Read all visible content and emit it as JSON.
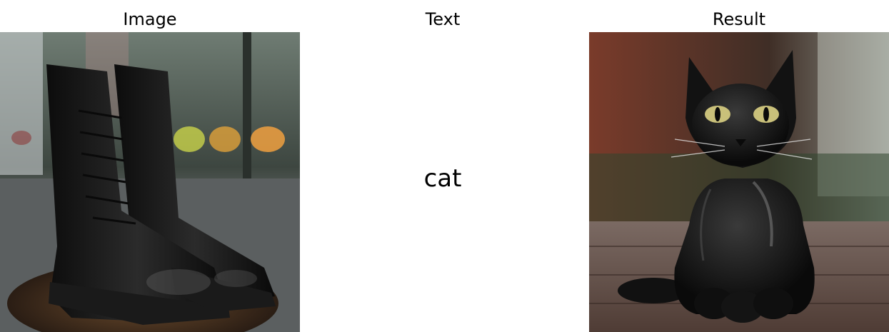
{
  "columns": {
    "image": "Image",
    "text": "Text",
    "result": "Result"
  },
  "prompt": "cat",
  "images": {
    "input": "black-leather-boots-rain-photo",
    "output": "black-cat-figurine-photo"
  },
  "colors": {
    "background": "#ffffff",
    "text": "#000000"
  }
}
